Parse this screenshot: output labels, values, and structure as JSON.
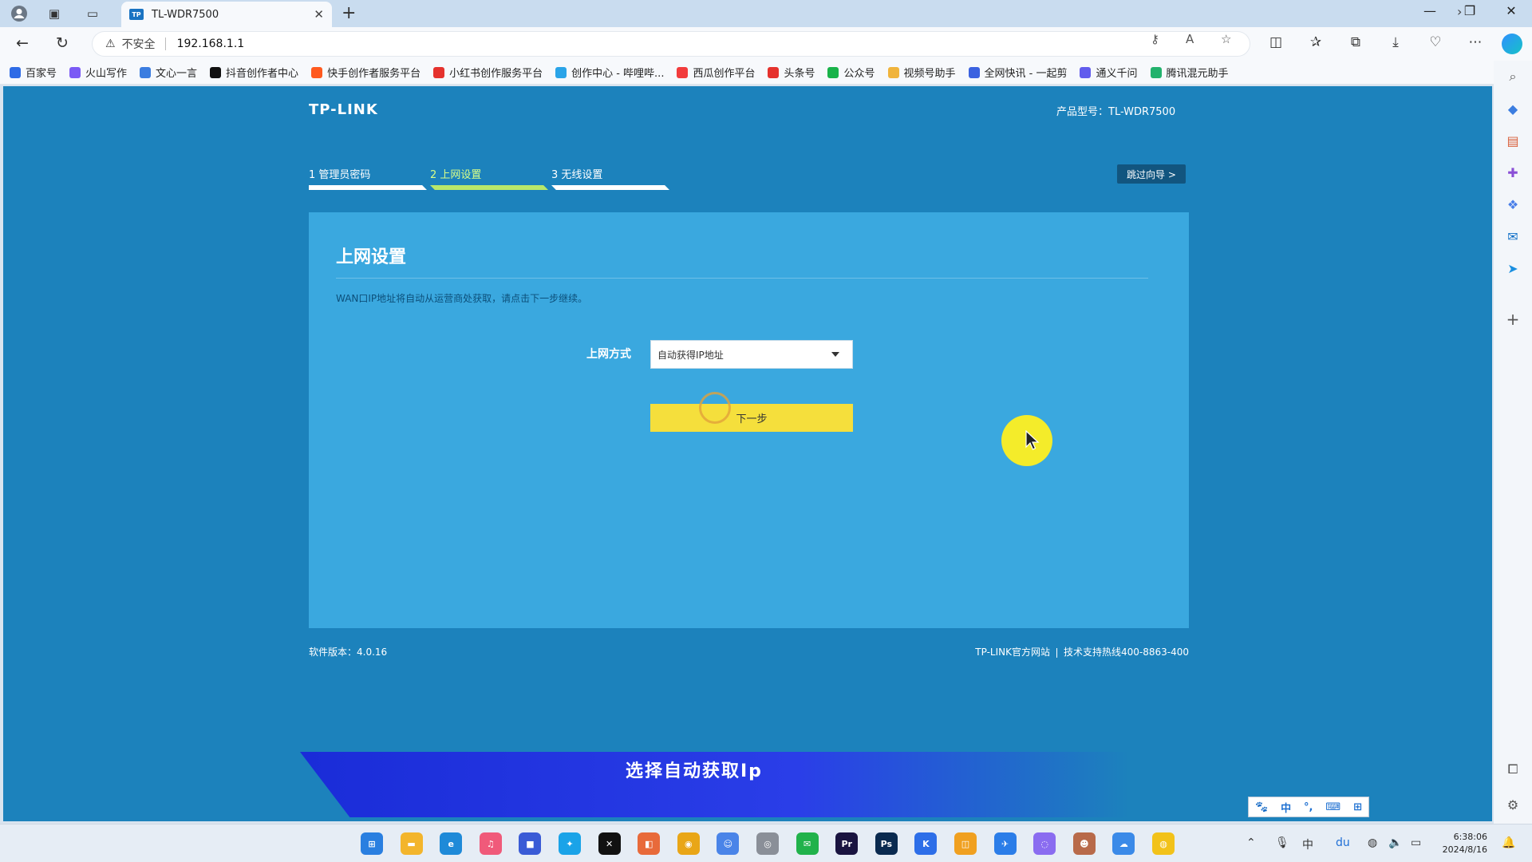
{
  "browser": {
    "tab_title": "TL-WDR7500",
    "tab_favicon_text": "TP",
    "security_label": "不安全",
    "url": "192.168.1.1",
    "bookmarks": [
      {
        "label": "百家号",
        "color": "#2e6be6"
      },
      {
        "label": "火山写作",
        "color": "#7a5af5"
      },
      {
        "label": "文心一言",
        "color": "#3b7de0"
      },
      {
        "label": "抖音创作者中心",
        "color": "#111111"
      },
      {
        "label": "快手创作者服务平台",
        "color": "#ff5a1f"
      },
      {
        "label": "小红书创作服务平台",
        "color": "#e5322d"
      },
      {
        "label": "创作中心 - 哔哩哔...",
        "color": "#2aa4e8"
      },
      {
        "label": "西瓜创作平台",
        "color": "#f23c3c"
      },
      {
        "label": "头条号",
        "color": "#e5322d"
      },
      {
        "label": "公众号",
        "color": "#19b34a"
      },
      {
        "label": "视频号助手",
        "color": "#f0b43c"
      },
      {
        "label": "全网快讯 - 一起剪",
        "color": "#3b62e0"
      },
      {
        "label": "通义千问",
        "color": "#615ced"
      },
      {
        "label": "腾讯混元助手",
        "color": "#23b26d"
      }
    ]
  },
  "router": {
    "logo": "TP-LINK",
    "model_label": "产品型号：TL-WDR7500",
    "steps": [
      {
        "label": "1 管理员密码",
        "active": false
      },
      {
        "label": "2 上网设置",
        "active": true
      },
      {
        "label": "3 无线设置",
        "active": false
      }
    ],
    "skip_label": "跳过向导 >",
    "panel_title": "上网设置",
    "panel_desc": "WAN口IP地址将自动从运营商处获取，请点击下一步继续。",
    "field_label": "上网方式",
    "select_value": "自动获得IP地址",
    "next_label": "下一步",
    "footer_version": "软件版本：4.0.16",
    "footer_site": "TP-LINK官方网站",
    "footer_hotline": "技术支持热线400-8863-400"
  },
  "overlay": {
    "caption": "选择自动获取Ip",
    "ime": [
      "🐾",
      "中",
      "°,",
      "⌨",
      "⊞"
    ]
  },
  "taskbar": {
    "time": "6:38:06",
    "date": "2024/8/16",
    "apps": [
      {
        "name": "start",
        "color": "#2a7fe0",
        "glyph": "⊞"
      },
      {
        "name": "files",
        "color": "#f3b52c",
        "glyph": "▬"
      },
      {
        "name": "edge",
        "color": "#1f8ad8",
        "glyph": "e"
      },
      {
        "name": "app-pink",
        "color": "#f05a7a",
        "glyph": "♫"
      },
      {
        "name": "store",
        "color": "#3a5bd6",
        "glyph": "■"
      },
      {
        "name": "app-blue",
        "color": "#1aa3e8",
        "glyph": "✦"
      },
      {
        "name": "capcut",
        "color": "#111111",
        "glyph": "✕"
      },
      {
        "name": "app-office",
        "color": "#e86a3a",
        "glyph": "◧"
      },
      {
        "name": "chrome",
        "color": "#e9a617",
        "glyph": "◉"
      },
      {
        "name": "app-bot",
        "color": "#4a84e8",
        "glyph": "☺"
      },
      {
        "name": "app-gray",
        "color": "#8a8f98",
        "glyph": "◎"
      },
      {
        "name": "wechat",
        "color": "#21b24b",
        "glyph": "✉"
      },
      {
        "name": "premiere",
        "color": "#1a1440",
        "glyph": "Pr"
      },
      {
        "name": "photoshop",
        "color": "#0a2a4f",
        "glyph": "Ps"
      },
      {
        "name": "app-k",
        "color": "#2d6ee8",
        "glyph": "K"
      },
      {
        "name": "app-orange",
        "color": "#f0a020",
        "glyph": "◫"
      },
      {
        "name": "app-bird",
        "color": "#2b7de8",
        "glyph": "✈"
      },
      {
        "name": "app-purple",
        "color": "#8a6cf0",
        "glyph": "◌"
      },
      {
        "name": "app-avatar",
        "color": "#b86a4a",
        "glyph": "☻"
      },
      {
        "name": "app-cloud",
        "color": "#3b8ae8",
        "glyph": "☁"
      },
      {
        "name": "app-yellow",
        "color": "#f2c21a",
        "glyph": "◍"
      }
    ]
  }
}
